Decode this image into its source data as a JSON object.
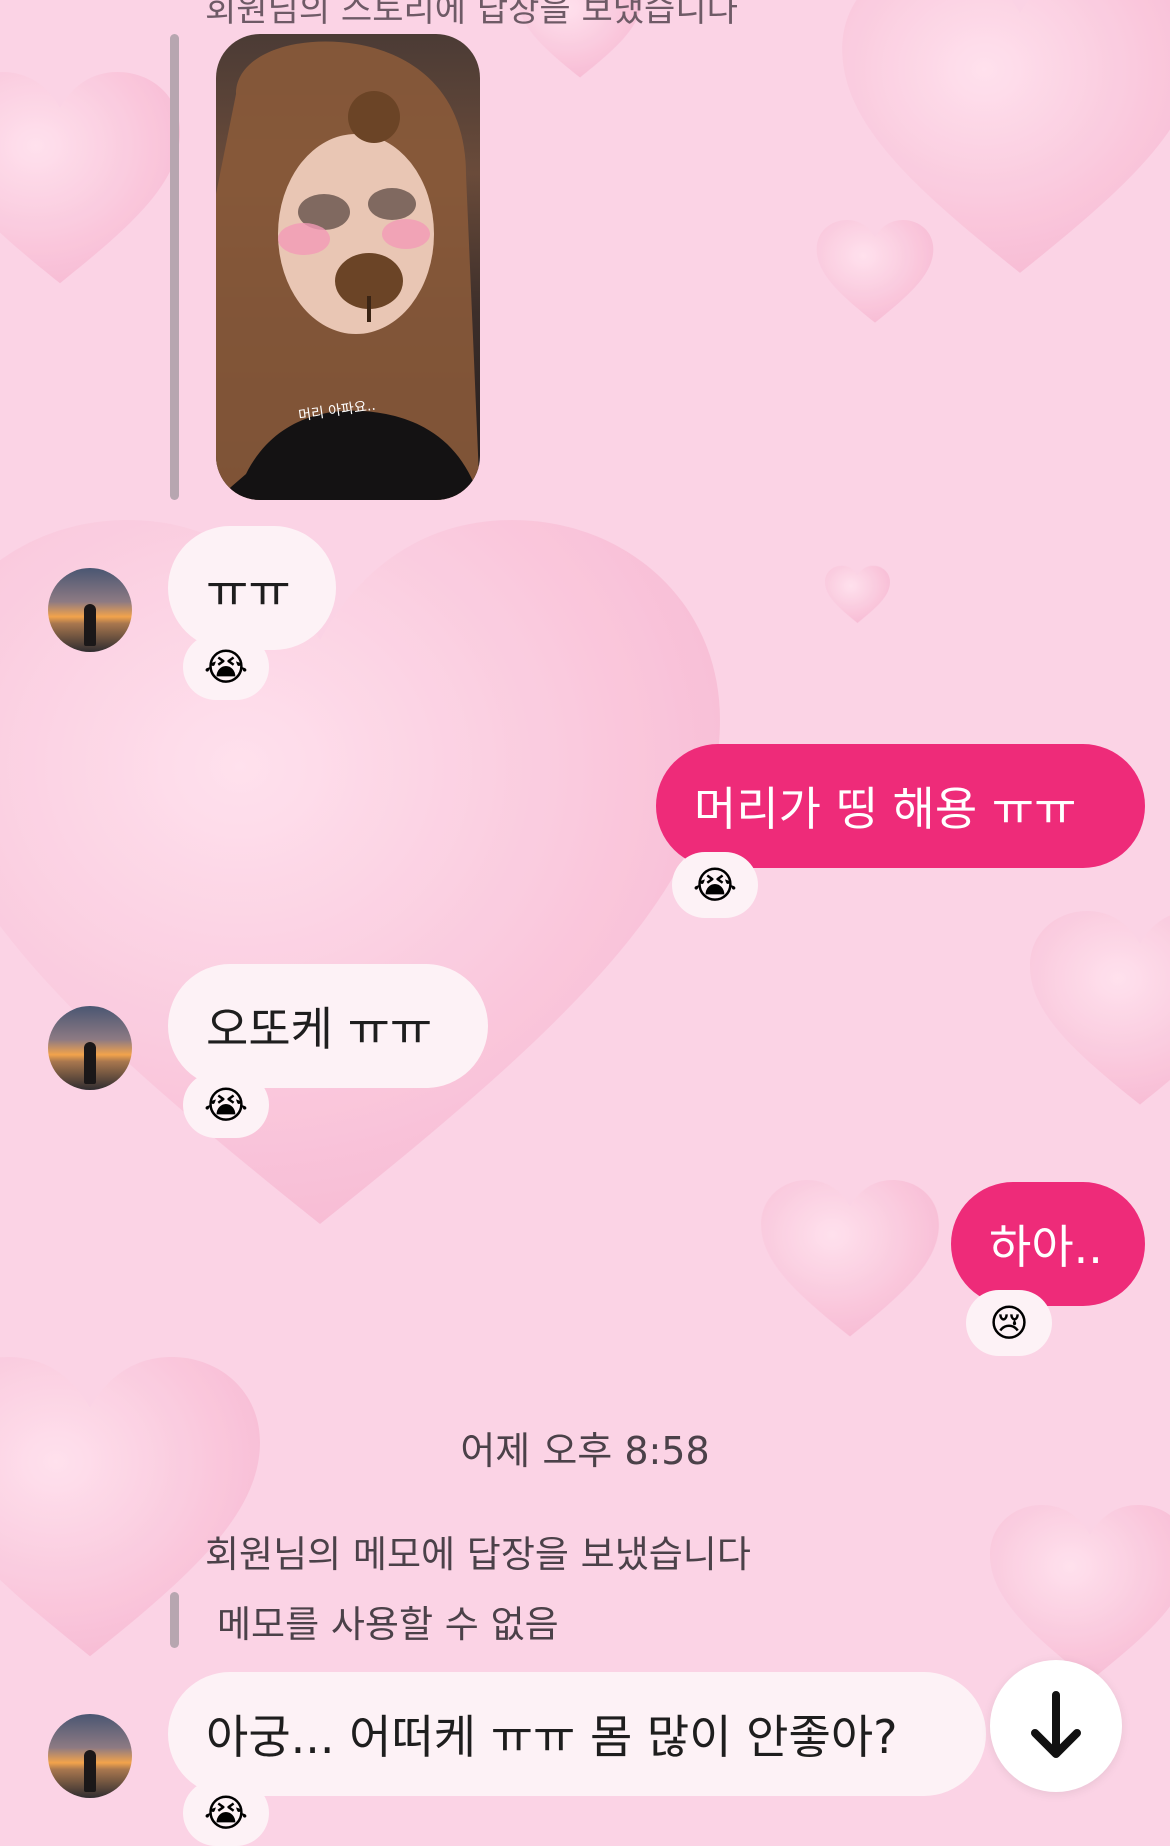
{
  "top_partial_text": "회원님의 스토리에 답장을 보냈습니다",
  "story": {
    "caption": "머리 아파요.."
  },
  "messages": [
    {
      "side": "in",
      "text": "ㅠㅠ",
      "reaction": "😭"
    },
    {
      "side": "out",
      "text": "머리가 띵 해용 ㅠㅠ",
      "reaction": "😭"
    },
    {
      "side": "in",
      "text": "오또케 ㅠㅠ",
      "reaction": "😭"
    },
    {
      "side": "out",
      "text": "하아..",
      "reaction": "😢"
    }
  ],
  "timestamp": "어제 오후 8:58",
  "memo_reply": {
    "notice": "회원님의 메모에 답장을 보냈습니다",
    "quote": "메모를 사용할 수 없음"
  },
  "last_message": {
    "text": "아궁... 어떠케 ㅠㅠ 몸 많이 안좋아?",
    "reaction": "😭"
  },
  "colors": {
    "outgoing_bubble": "#ee2b79",
    "incoming_bubble": "#fdf2f6",
    "background": "#fbd3e5"
  },
  "icons": {
    "scroll_down": "arrow-down-icon"
  }
}
